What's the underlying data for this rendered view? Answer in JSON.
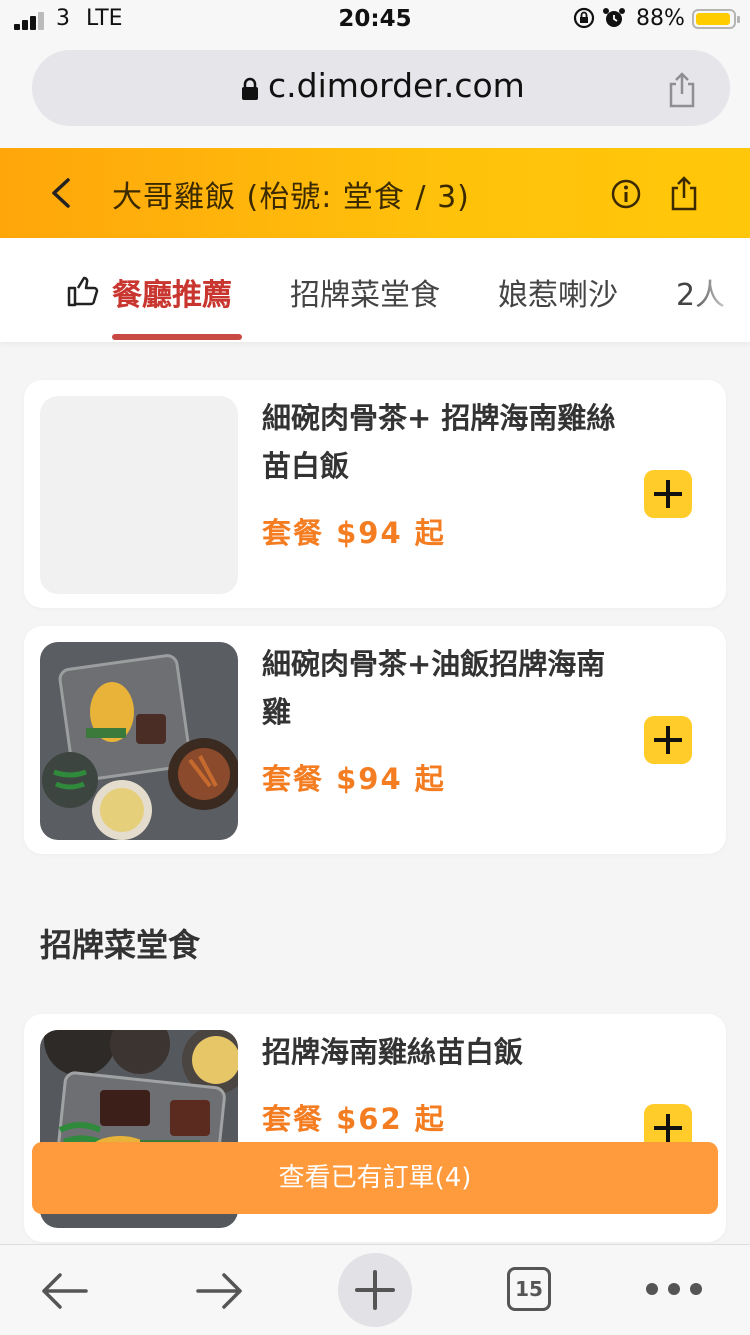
{
  "status_bar": {
    "carrier": "3",
    "network": "LTE",
    "time": "20:45",
    "battery_percent": "88%",
    "battery_level": 0.88
  },
  "browser": {
    "url": "c.dimorder.com"
  },
  "header": {
    "title": "大哥雞飯 (枱號: 堂食 / 3)"
  },
  "tabs": [
    {
      "label": "餐廳推薦",
      "active": true
    },
    {
      "label": "招牌菜堂食",
      "active": false
    },
    {
      "label": "娘惹喇沙",
      "active": false
    },
    {
      "label": "2人",
      "active": false
    }
  ],
  "recommended_items": [
    {
      "name": "細碗肉骨茶+ 招牌海南雞絲苗白飯",
      "price": "套餐 $94 起",
      "has_image": false
    },
    {
      "name": "細碗肉骨茶+油飯招牌海南雞",
      "price": "套餐 $94 起",
      "has_image": true
    }
  ],
  "section": {
    "title": "招牌菜堂食",
    "items": [
      {
        "name": "招牌海南雞絲苗白飯",
        "price": "套餐 $62 起",
        "has_image": true
      }
    ]
  },
  "order_button": {
    "label": "查看已有訂單(4)"
  },
  "toolbar": {
    "tab_count": "15"
  },
  "colors": {
    "accent": "#ffc20b",
    "active_tab": "#c8362f",
    "price": "#f47d22",
    "add_button": "#ffcc29",
    "order_button": "#ff9a3d"
  }
}
